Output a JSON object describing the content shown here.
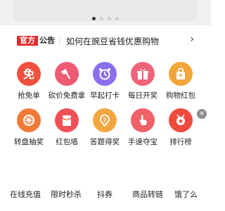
{
  "carousel": {
    "active_index": 0,
    "dot_count": 4
  },
  "notice": {
    "tag_left": "官方",
    "tag_right": "公告",
    "text": "如何在豌豆省钱优惠购物",
    "arrow": "›"
  },
  "grid": {
    "row1": [
      {
        "label": "抢免单",
        "icon": "free-icon",
        "color": "#f0503c"
      },
      {
        "label": "砍价免费拿",
        "icon": "axe-icon",
        "color": "#ef5a73"
      },
      {
        "label": "早起打卡",
        "icon": "alarm-clock-icon",
        "color": "#8a6ef0"
      },
      {
        "label": "每日开奖",
        "icon": "gift-icon",
        "color": "#f06479"
      },
      {
        "label": "购物红包",
        "icon": "shopping-bag-icon",
        "color": "#f2a63a"
      }
    ],
    "row2": [
      {
        "label": "转盘抽奖",
        "icon": "wheel-icon",
        "color": "#f27a37"
      },
      {
        "label": "红包墙",
        "icon": "red-envelope-icon",
        "color": "#ef4f55"
      },
      {
        "label": "答题得奖",
        "icon": "question-icon",
        "color": "#f3a640"
      },
      {
        "label": "手速夺宝",
        "icon": "hand-tap-icon",
        "color": "#f06067"
      },
      {
        "label": "排行榜",
        "icon": "medal-icon",
        "color": "#ef4b3d"
      }
    ]
  },
  "close_badge": "×",
  "bottom_bar": [
    "在线充值",
    "限时秒杀",
    "抖券",
    "商品转链",
    "饿了么"
  ]
}
